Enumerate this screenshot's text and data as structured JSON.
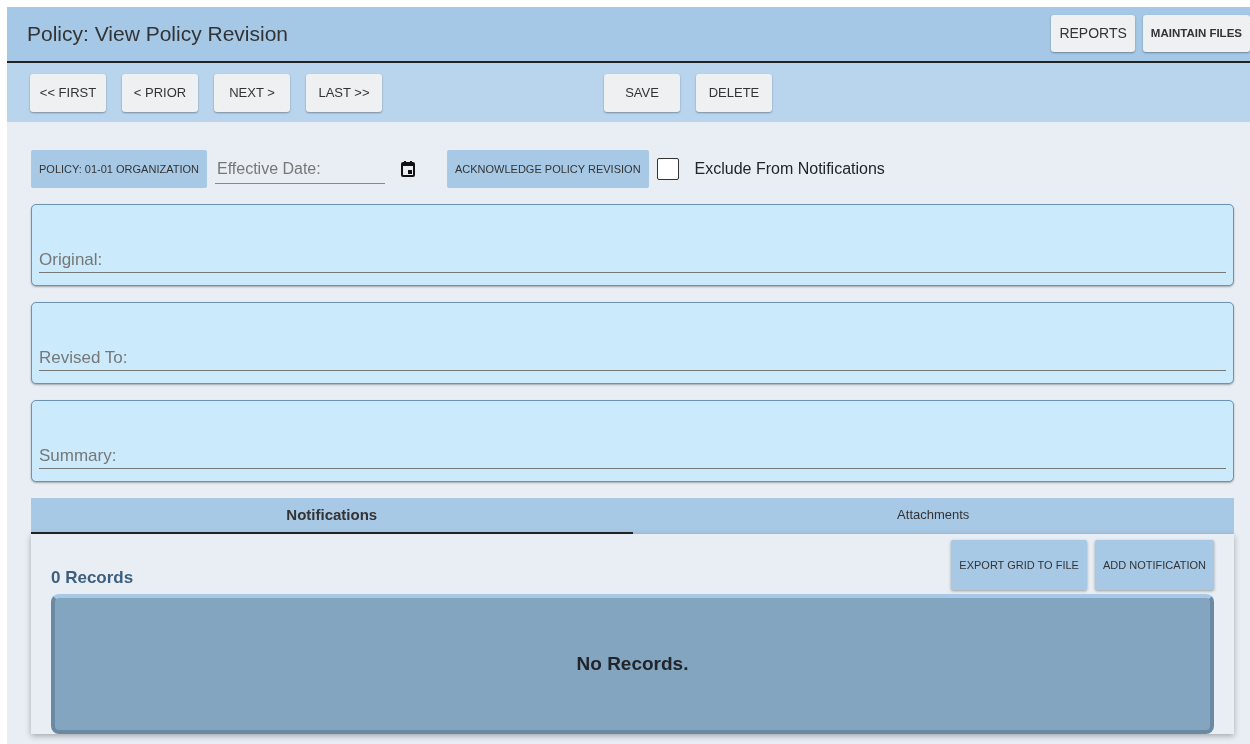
{
  "window": {
    "title": "Policy: View Policy Revision"
  },
  "header_buttons": [
    "REPORTS",
    "MAINTAIN FILES"
  ],
  "nav_buttons": [
    "<< FIRST",
    "< PRIOR",
    "NEXT >",
    "LAST >>"
  ],
  "action_buttons": [
    "SAVE",
    "DELETE"
  ],
  "policy_button": "POLICY: 01-01 ORGANIZATION",
  "effective_date": {
    "placeholder": "Effective Date:"
  },
  "acknowledge_button": "ACKNOWLEDGE POLICY REVISION",
  "exclude_checkbox": {
    "label": "Exclude From Notifications",
    "checked": false
  },
  "text_areas": [
    {
      "placeholder": "Original:"
    },
    {
      "placeholder": "Revised To:"
    },
    {
      "placeholder": "Summary:"
    }
  ],
  "tabs": [
    {
      "label": "Notifications",
      "selected": true
    },
    {
      "label": "Attachments",
      "selected": false
    }
  ],
  "grid": {
    "count": "0 Records",
    "buttons": [
      "EXPORT GRID TO FILE",
      "ADD NOTIFICATION"
    ],
    "empty": "No Records."
  }
}
